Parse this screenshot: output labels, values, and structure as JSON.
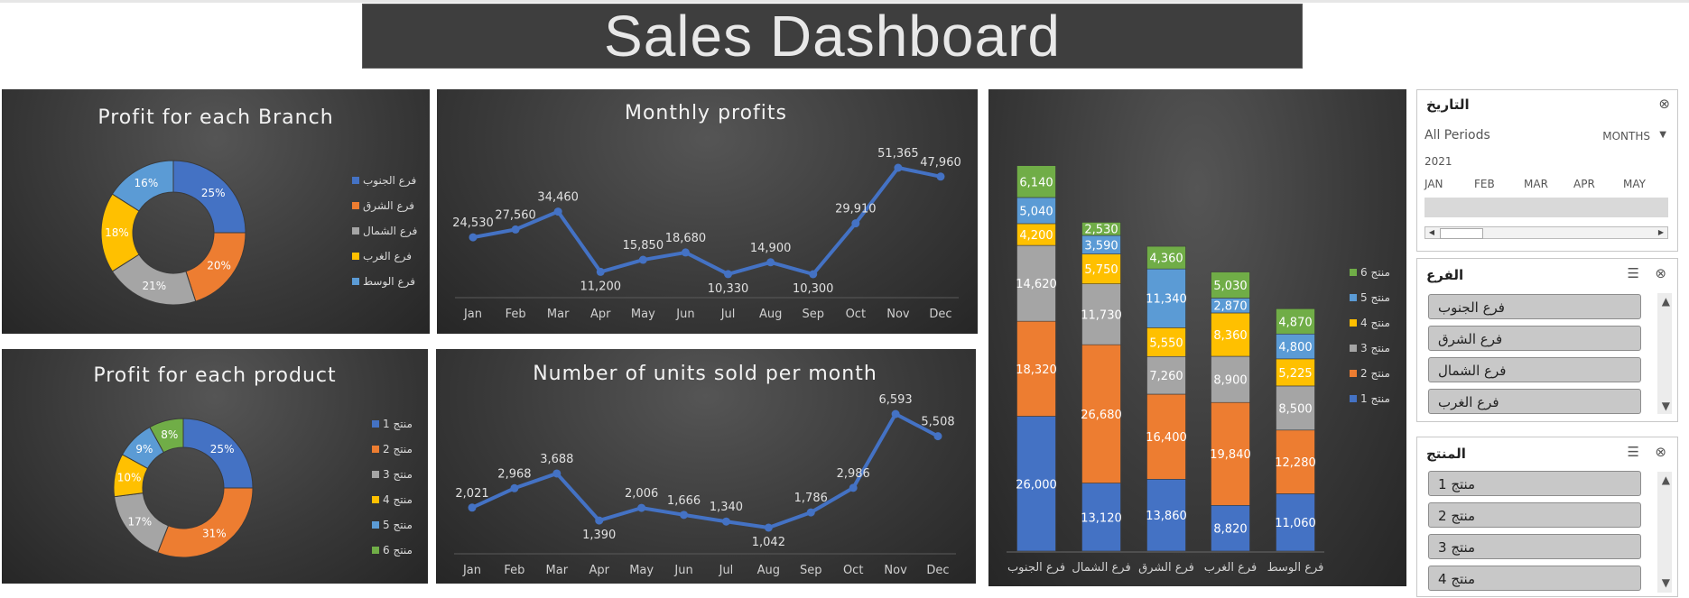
{
  "header": {
    "title": "Sales Dashboard"
  },
  "colors": {
    "blue": "#4472c4",
    "orange": "#ed7d31",
    "gray": "#a5a5a5",
    "yellow": "#ffc000",
    "lightblue": "#5b9bd5",
    "green": "#70ad47"
  },
  "timeline": {
    "title": "التاريخ",
    "period_label": "All Periods",
    "unit_label": "MONTHS",
    "year": "2021",
    "months": [
      "JAN",
      "FEB",
      "MAR",
      "APR",
      "MAY"
    ]
  },
  "branch_slicer": {
    "title": "الفرع",
    "items": [
      "فرع الجنوب",
      "فرع الشرق",
      "فرع الشمال",
      "فرع الغرب"
    ]
  },
  "product_slicer": {
    "title": "المنتج",
    "items": [
      "منتج 1",
      "منتج 2",
      "منتج 3",
      "منتج 4"
    ]
  },
  "chart_data": [
    {
      "id": "branch_donut",
      "type": "pie",
      "title": "Profit for each Branch",
      "legend_position": "right",
      "slices": [
        {
          "label": "فرع الجنوب",
          "value": 25,
          "display": "25%",
          "color": "#4472c4"
        },
        {
          "label": "فرع الشرق",
          "value": 20,
          "display": "20%",
          "color": "#ed7d31"
        },
        {
          "label": "فرع الشمال",
          "value": 21,
          "display": "21%",
          "color": "#a5a5a5"
        },
        {
          "label": "فرع الغرب",
          "value": 18,
          "display": "18%",
          "color": "#ffc000"
        },
        {
          "label": "فرع الوسط",
          "value": 16,
          "display": "16%",
          "color": "#5b9bd5"
        }
      ]
    },
    {
      "id": "monthly_profits",
      "type": "line",
      "title": "Monthly profits",
      "categories": [
        "Jan",
        "Feb",
        "Mar",
        "Apr",
        "May",
        "Jun",
        "Jul",
        "Aug",
        "Sep",
        "Oct",
        "Nov",
        "Dec"
      ],
      "values": [
        24530,
        27560,
        34460,
        11200,
        15850,
        18680,
        10330,
        14900,
        10300,
        29910,
        51365,
        47960
      ],
      "labels": [
        "24,530",
        "27,560",
        "34,460",
        "11,200",
        "15,850",
        "18,680",
        "10,330",
        "14,900",
        "10,300",
        "29,910",
        "51,365",
        "47,960"
      ]
    },
    {
      "id": "product_donut",
      "type": "pie",
      "title": "Profit for each product",
      "legend_position": "right",
      "slices": [
        {
          "label": "منتج 1",
          "value": 25,
          "display": "25%",
          "color": "#4472c4"
        },
        {
          "label": "منتج 2",
          "value": 31,
          "display": "31%",
          "color": "#ed7d31"
        },
        {
          "label": "منتج 3",
          "value": 17,
          "display": "17%",
          "color": "#a5a5a5"
        },
        {
          "label": "منتج 4",
          "value": 10,
          "display": "10%",
          "color": "#ffc000"
        },
        {
          "label": "منتج 5",
          "value": 9,
          "display": "9%",
          "color": "#5b9bd5"
        },
        {
          "label": "منتج 6",
          "value": 8,
          "display": "8%",
          "color": "#70ad47"
        }
      ]
    },
    {
      "id": "units_sold",
      "type": "line",
      "title": "Number of units sold per month",
      "categories": [
        "Jan",
        "Feb",
        "Mar",
        "Apr",
        "May",
        "Jun",
        "Jul",
        "Aug",
        "Sep",
        "Oct",
        "Nov",
        "Dec"
      ],
      "values": [
        2021,
        2968,
        3688,
        1390,
        2006,
        1666,
        1340,
        1042,
        1786,
        2986,
        6593,
        5508
      ],
      "labels": [
        "2,021",
        "2,968",
        "3,688",
        "1,390",
        "2,006",
        "1,666",
        "1,340",
        "1,042",
        "1,786",
        "2,986",
        "6,593",
        "5,508"
      ]
    },
    {
      "id": "stacked_branch_product",
      "type": "bar",
      "stacked": true,
      "legend_position": "right",
      "categories": [
        "فرع الجنوب",
        "فرع الشمال",
        "فرع الشرق",
        "فرع الغرب",
        "فرع الوسط"
      ],
      "series": [
        {
          "name": "منتج 1",
          "color": "#4472c4",
          "values": [
            26000,
            13120,
            13860,
            8820,
            11060
          ],
          "labels": [
            "26,000",
            "13,120",
            "13,860",
            "8,820",
            "11,060"
          ]
        },
        {
          "name": "منتج 2",
          "color": "#ed7d31",
          "values": [
            18320,
            26680,
            16400,
            19840,
            12280
          ],
          "labels": [
            "18,320",
            "26,680",
            "16,400",
            "19,840",
            "12,280"
          ]
        },
        {
          "name": "منتج 3",
          "color": "#a5a5a5",
          "values": [
            14620,
            11730,
            7260,
            8900,
            8500
          ],
          "labels": [
            "14,620",
            "11,730",
            "7,260",
            "8,900",
            "8,500"
          ]
        },
        {
          "name": "منتج 4",
          "color": "#ffc000",
          "values": [
            4200,
            5750,
            5550,
            8360,
            5225
          ],
          "labels": [
            "4,200",
            "5,750",
            "5,550",
            "8,360",
            "5,225"
          ]
        },
        {
          "name": "منتج 5",
          "color": "#5b9bd5",
          "values": [
            5040,
            3590,
            11340,
            2870,
            4800
          ],
          "labels": [
            "5,040",
            "3,590",
            "11,340",
            "2,870",
            "4,800"
          ]
        },
        {
          "name": "منتج 6",
          "color": "#70ad47",
          "values": [
            6140,
            2530,
            4360,
            5030,
            4870
          ],
          "labels": [
            "6,140",
            "2,530",
            "4,360",
            "5,030",
            "4,870"
          ]
        }
      ]
    }
  ]
}
